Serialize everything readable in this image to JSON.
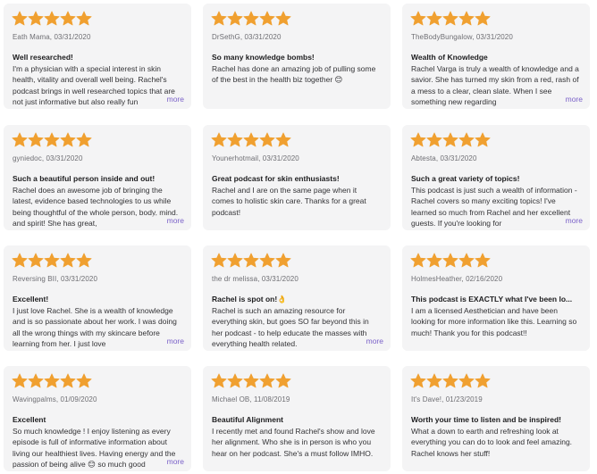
{
  "accent_star_color": "#f0a030",
  "more_link_color": "#7b62c9",
  "more_label": "more",
  "reviews": [
    {
      "rating": 5,
      "author_date": "Eath Mama, 03/31/2020",
      "title": "Well researched!",
      "body": "I'm a physician with a special interest in skin health, vitality and overall well being. Rachel's podcast brings in well researched topics that are not just informative but also really fun",
      "has_more": true
    },
    {
      "rating": 5,
      "author_date": "DrSethG, 03/31/2020",
      "title": "So many knowledge bombs!",
      "body": "Rachel has done an amazing job of pulling some of the best in the health biz together 😊",
      "has_more": false
    },
    {
      "rating": 5,
      "author_date": "TheBodyBungalow, 03/31/2020",
      "title": "Wealth of Knowledge",
      "body": "Rachel Varga is truly a wealth of knowledge and a savior. She has turned my skin from a red, rash of a mess to a clear, clean slate. When I see something new regarding",
      "has_more": true
    },
    {
      "rating": 5,
      "author_date": "gyniedoc, 03/31/2020",
      "title": "Such a beautiful person inside and out!",
      "body": "Rachel does an awesome job of bringing the latest, evidence based technologies to us while being thoughtful of the whole person, body, mind, and spirit! She has great,",
      "has_more": true
    },
    {
      "rating": 5,
      "author_date": "Younerhotmail, 03/31/2020",
      "title": "Great podcast for skin enthusiasts!",
      "body": "Rachel and I are on the same page when it comes to holistic skin care. Thanks for a great podcast!",
      "has_more": false
    },
    {
      "rating": 5,
      "author_date": "Abtesta, 03/31/2020",
      "title": "Such a great variety of topics!",
      "body": "This podcast is just such a wealth of information - Rachel covers so many exciting topics! I've learned so much from Rachel and her excellent guests. If you're looking for",
      "has_more": true
    },
    {
      "rating": 5,
      "author_date": "Reversing BII, 03/31/2020",
      "title": "Excellent!",
      "body": "I just love Rachel. She is a wealth of knowledge and is so passionate about her work. I was doing all the wrong things with my skincare before learning from her. I just love",
      "has_more": true
    },
    {
      "rating": 5,
      "author_date": "the dr melissa, 03/31/2020",
      "title": "Rachel is spot on!👌",
      "body": "Rachel is such an amazing resource for everything skin, but goes SO far beyond this in her podcast - to help educate the masses with everything health related.",
      "has_more": true
    },
    {
      "rating": 5,
      "author_date": "HolmesHeather, 02/16/2020",
      "title": "This podcast is EXACTLY what I've been lo...",
      "body": "I am a licensed Aesthetician and have been looking for more information like this. Learning so much! Thank you for this podcast!!",
      "has_more": false
    },
    {
      "rating": 5,
      "author_date": "Wavingpalms, 01/09/2020",
      "title": "Excellent",
      "body": "So much knowledge ! I enjoy listening as every episode is full of informative information about living our healthiest lives. Having energy and the passion of being alive 😊 so much good",
      "has_more": true
    },
    {
      "rating": 5,
      "author_date": "Michael OB, 11/08/2019",
      "title": "Beautiful Alignment",
      "body": "I recently met and found Rachel's show and love her alignment. Who she is in person is who you hear on her podcast. She's a must follow IMHO.",
      "has_more": false
    },
    {
      "rating": 5,
      "author_date": "It's Dave!, 01/23/2019",
      "title": "Worth your time to listen and be inspired!",
      "body": "What a down to earth and refreshing look at everything you can do to look and feel amazing. Rachel knows her stuff!",
      "has_more": false
    }
  ]
}
